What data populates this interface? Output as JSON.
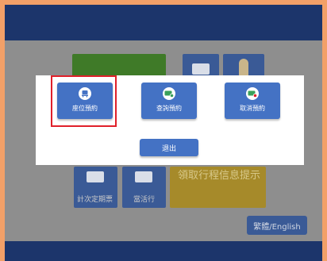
{
  "modal": {
    "options": [
      {
        "label": "座位預約",
        "icon": "seat-icon"
      },
      {
        "label": "查詢預約",
        "icon": "ticket-check-icon"
      },
      {
        "label": "取消預約",
        "icon": "ticket-cancel-icon"
      }
    ],
    "exit_label": "退出"
  },
  "background": {
    "tiles": [
      {
        "label": "計次定期票",
        "icon": "card-icon"
      },
      {
        "label": "當活行",
        "icon": "ticket-icon"
      }
    ],
    "info_text": "領取行程信息提示",
    "language_button": "繁體/English"
  },
  "colors": {
    "accent": "#4472c4",
    "topbar": "#1c356b",
    "highlight": "#e0202a",
    "frame": "#f2a068"
  }
}
